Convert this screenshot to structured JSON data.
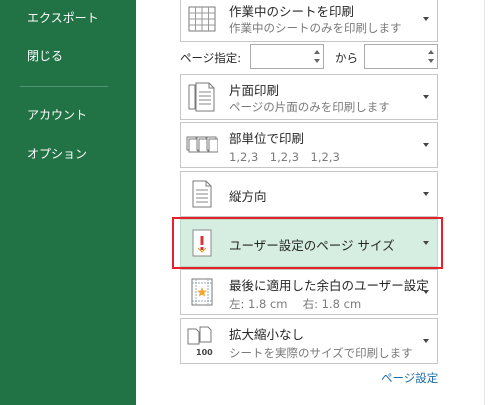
{
  "sidebar": {
    "items": [
      {
        "label": "エクスポート"
      },
      {
        "label": "閉じる"
      },
      {
        "label": "アカウント"
      },
      {
        "label": "オプション"
      }
    ]
  },
  "print_what": {
    "title": "作業中のシートを印刷",
    "subtitle": "作業中のシートのみを印刷します",
    "icon": "grid-sheet-icon"
  },
  "pages": {
    "label": "ページ指定:",
    "from_value": "",
    "to_label": "から",
    "to_value": ""
  },
  "sides": {
    "title": "片面印刷",
    "subtitle": "ページの片面のみを印刷します",
    "icon": "single-sided-icon"
  },
  "collate": {
    "title": "部単位で印刷",
    "subtitle": "1,2,3　1,2,3　1,2,3",
    "icon": "collated-icon"
  },
  "orientation": {
    "title": "縦方向",
    "icon": "portrait-icon"
  },
  "paper_size": {
    "title": "ユーザー設定のページ サイズ",
    "icon": "custom-page-size-icon",
    "selected": true
  },
  "margins": {
    "title": "最後に適用した余白のユーザー設定",
    "subtitle": "左:  1.8 cm　 右:  1.8 cm",
    "icon": "margins-icon"
  },
  "scaling": {
    "title": "拡大縮小なし",
    "subtitle": "シートを実際のサイズで印刷します",
    "icon": "no-scaling-icon",
    "icon_text": "100"
  },
  "page_setup_link": "ページ設定",
  "colors": {
    "sidebar": "#217346",
    "selected_bg": "#d5eee1",
    "highlight": "#e52229",
    "link": "#1a6aa8"
  }
}
